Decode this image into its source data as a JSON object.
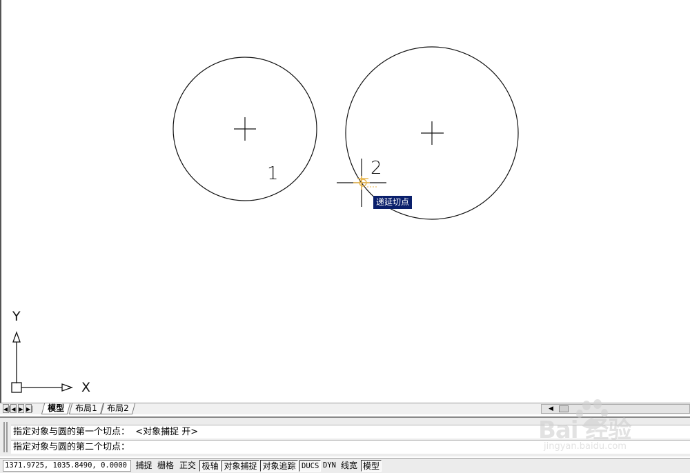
{
  "drawing": {
    "circle_labels": [
      "1",
      "2"
    ],
    "snap_tooltip": "递延切点",
    "ucs_axes": {
      "x": "X",
      "y": "Y"
    }
  },
  "tabs": {
    "nav_buttons": [
      "first-icon",
      "prev-icon",
      "next-icon",
      "last-icon"
    ],
    "items": [
      {
        "label": "模型",
        "active": true
      },
      {
        "label": "布局1",
        "active": false
      },
      {
        "label": "布局2",
        "active": false
      }
    ]
  },
  "command": {
    "line1": "指定对象与圆的第一个切点：  <对象捕捉 开>",
    "line2": "指定对象与圆的第二个切点："
  },
  "status": {
    "coordinates": "1371.9725, 1035.8490, 0.0000",
    "toggles": [
      {
        "label": "捕捉",
        "on": false
      },
      {
        "label": "栅格",
        "on": false
      },
      {
        "label": "正交",
        "on": false
      },
      {
        "label": "极轴",
        "on": true
      },
      {
        "label": "对象捕捉",
        "on": true
      },
      {
        "label": "对象追踪",
        "on": true
      },
      {
        "label": "DUCS",
        "on": true
      },
      {
        "label": "DYN",
        "on": false
      },
      {
        "label": "线宽",
        "on": false
      },
      {
        "label": "模型",
        "on": true
      }
    ]
  },
  "watermark": {
    "brand": "Bai 经验",
    "url": "jingyan.baidu.com"
  },
  "colors": {
    "tooltip_bg": "#0a1f6b",
    "snap_marker": "#e8b54a",
    "line": "#111111"
  }
}
